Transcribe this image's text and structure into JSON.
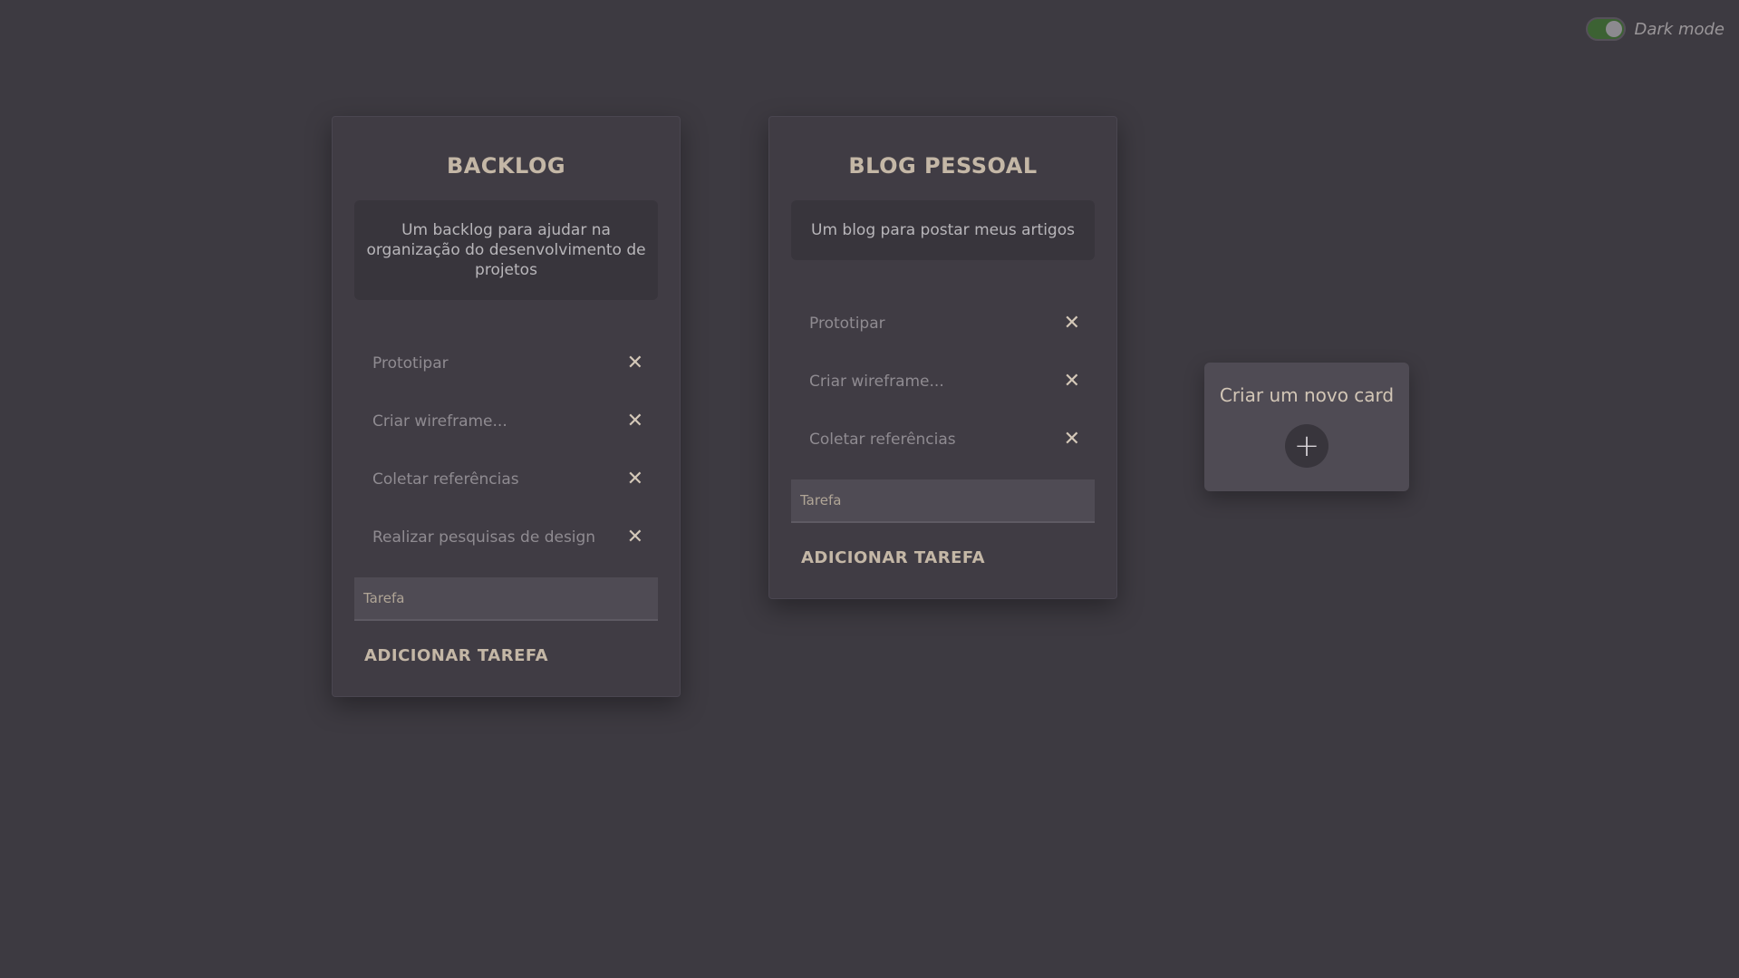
{
  "theme": {
    "background": "#3d3a41",
    "card_background": "#403c44",
    "accent": "#c4b7a6",
    "toggle_on": "#3c6233"
  },
  "dark_mode": {
    "label": "Dark mode",
    "enabled": true
  },
  "cards": [
    {
      "title": "BACKLOG",
      "description": "Um backlog para ajudar na organização do desenvolvimento de projetos",
      "tasks": [
        {
          "label": "Prototipar",
          "remove_icon": "close-icon"
        },
        {
          "label": "Criar wireframe...",
          "remove_icon": "close-icon"
        },
        {
          "label": "Coletar referências",
          "remove_icon": "close-icon"
        },
        {
          "label": "Realizar pesquisas de design",
          "remove_icon": "close-icon"
        }
      ],
      "input_placeholder": "Tarefa",
      "add_button_label": "ADICIONAR TAREFA"
    },
    {
      "title": "BLOG PESSOAL",
      "description": "Um blog para postar meus artigos",
      "tasks": [
        {
          "label": "Prototipar",
          "remove_icon": "close-icon"
        },
        {
          "label": "Criar wireframe...",
          "remove_icon": "close-icon"
        },
        {
          "label": "Coletar referências",
          "remove_icon": "close-icon"
        }
      ],
      "input_placeholder": "Tarefa",
      "add_button_label": "ADICIONAR TAREFA"
    }
  ],
  "new_card": {
    "label": "Criar um novo card",
    "icon": "plus-icon"
  },
  "icons": {
    "close": "✕",
    "plus": "+"
  }
}
